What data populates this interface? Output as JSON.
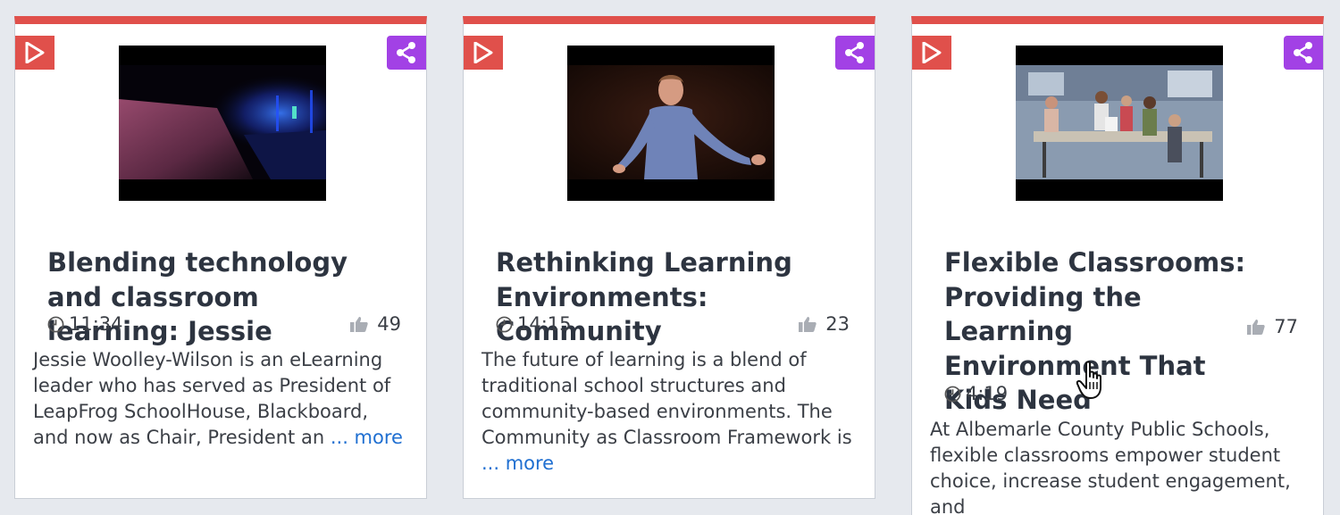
{
  "cards": [
    {
      "title": "Blending technology and classroom learning: Jessie",
      "duration": "11:34",
      "likes": "49",
      "description": "Jessie Woolley-Wilson is an eLearning leader who has served as President of LeapFrog SchoolHouse, Blackboard, and now as Chair, President an",
      "more_label": "... more"
    },
    {
      "title": "Rethinking Learning Environments: Community",
      "duration": "14:15",
      "likes": "23",
      "description": "The future of learning is a blend of traditional school structures and community-based environments. The Community as Classroom Framework is",
      "more_label": "... more"
    },
    {
      "title": "Flexible Classrooms: Providing the Learning Environment That Kids Need",
      "duration": "4:19",
      "likes": "77",
      "description": "At Albemarle County Public Schools, flexible classrooms empower student choice, increase student engagement, and"
    }
  ],
  "icons": {
    "play": "play-icon",
    "share": "share-icon",
    "clock": "clock-icon",
    "like": "thumbs-up-icon"
  },
  "colors": {
    "accent": "#e0504b",
    "share": "#a241e5",
    "link": "#1f6fd1",
    "title": "#2d3440",
    "background": "#e6e9ee"
  }
}
